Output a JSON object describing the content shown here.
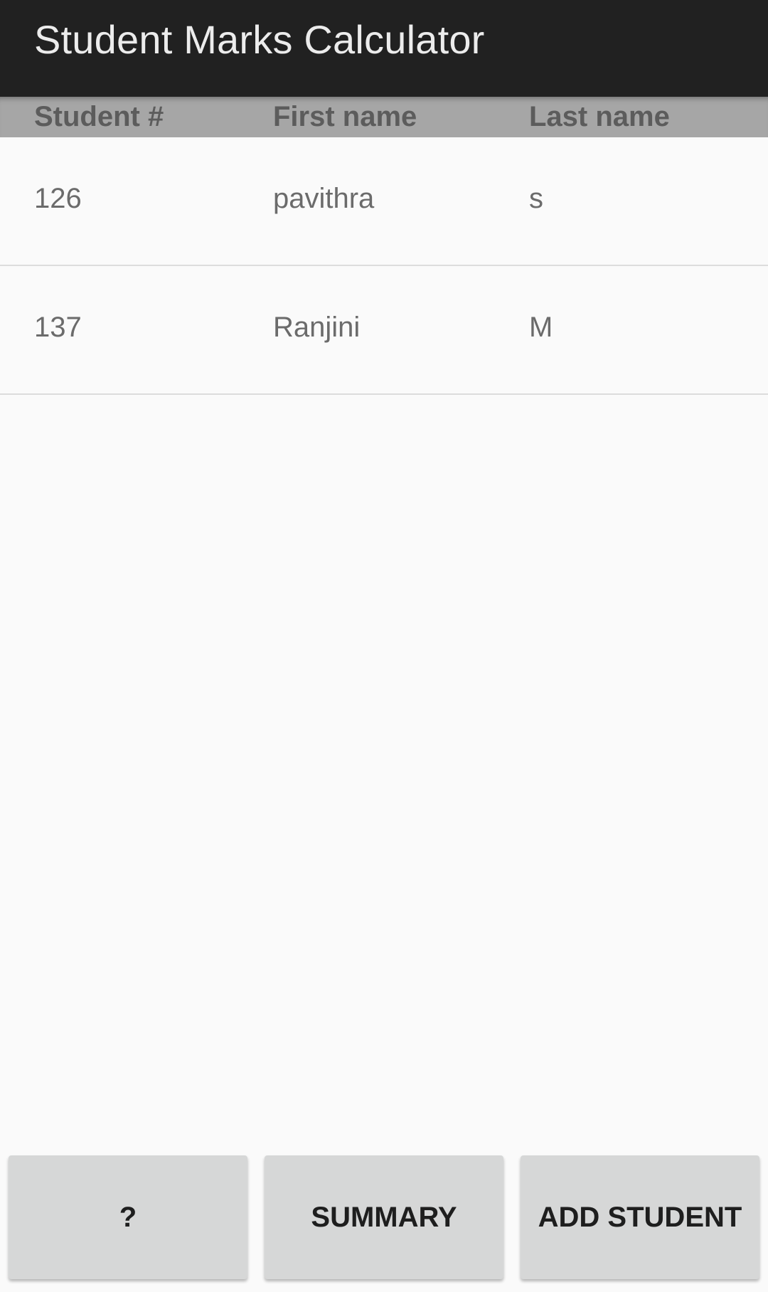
{
  "app_bar": {
    "title": "Student Marks Calculator"
  },
  "table": {
    "headers": [
      "Student #",
      "First name",
      "Last name"
    ],
    "rows": [
      {
        "student_no": "126",
        "first_name": "pavithra",
        "last_name": "s"
      },
      {
        "student_no": "137",
        "first_name": "Ranjini",
        "last_name": "M"
      }
    ]
  },
  "buttons": {
    "help_label": "?",
    "summary_label": "SUMMARY",
    "add_student_label": "ADD STUDENT"
  },
  "colors": {
    "app_bar": "#212121",
    "header_row": "#a6a6a6",
    "background": "#fafafa",
    "button": "#d6d7d7"
  }
}
